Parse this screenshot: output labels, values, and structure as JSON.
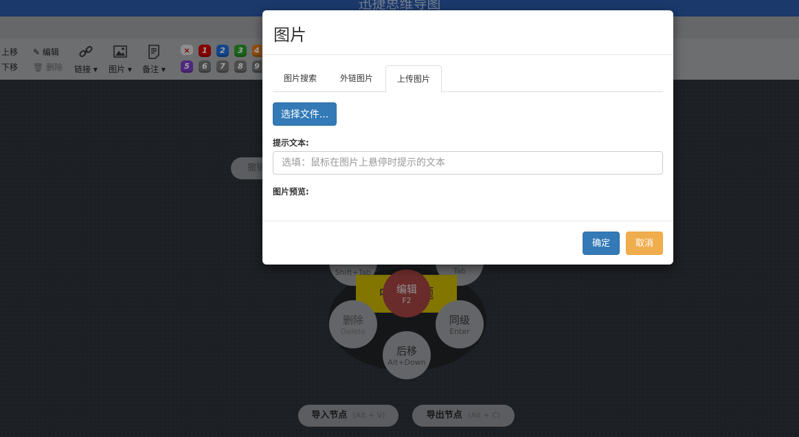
{
  "app": {
    "title": "迅捷思维导图"
  },
  "toolbar": {
    "move_up": "上移",
    "move_down": "下移",
    "edit": "编辑",
    "delete": "删除",
    "link": "链接",
    "image": "图片",
    "note": "备注",
    "priorities_row1": [
      "×",
      "1",
      "2",
      "3",
      "4"
    ],
    "priorities_row2": [
      "5",
      "6",
      "7",
      "8",
      "9"
    ]
  },
  "canvas": {
    "undo_partial": "撤销",
    "center_topic": "中心主题",
    "menu": {
      "edit": {
        "label": "编辑",
        "key": "F2"
      },
      "sibling": {
        "label": "同级",
        "key": "Enter"
      },
      "delete": {
        "label": "删除",
        "key": "Delete"
      },
      "after": {
        "label": "后移",
        "key": "Alt+Down"
      },
      "child_key": "Tab",
      "parent_key": "Shift+Tab"
    },
    "import": {
      "label": "导入节点",
      "key": "(Alt + V)"
    },
    "export": {
      "label": "导出节点",
      "key": "(Alt + C)"
    }
  },
  "dialog": {
    "title": "图片",
    "tabs": [
      {
        "label": "图片搜索"
      },
      {
        "label": "外链图片"
      },
      {
        "label": "上传图片"
      }
    ],
    "choose_file": "选择文件...",
    "hint_label": "提示文本:",
    "hint_placeholder": "选填：鼠标在图片上悬停时提示的文本",
    "preview_label": "图片预览:",
    "ok": "确定",
    "cancel": "取消"
  },
  "colors": {
    "header": "#2a58a5",
    "primary": "#337ab7",
    "warning": "#f0ad4e",
    "center_node": "#c9b500",
    "edit_node": "#a34242"
  }
}
